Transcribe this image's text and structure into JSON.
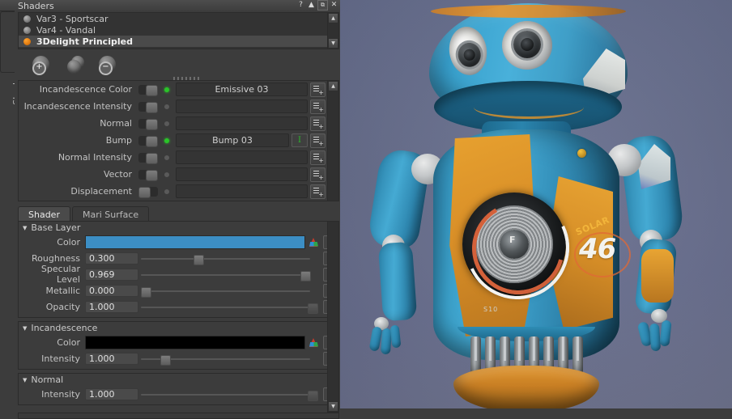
{
  "window": {
    "title": "Shaders",
    "side_tab": "Shaders",
    "buttons": [
      {
        "name": "help-button",
        "glyph": "?"
      },
      {
        "name": "float-button",
        "glyph": "▲"
      },
      {
        "name": "restore-button",
        "glyph": "⧉"
      },
      {
        "name": "close-button",
        "glyph": "✕"
      }
    ]
  },
  "shader_list": {
    "items": [
      {
        "label": "Var3 - Sportscar",
        "active": false
      },
      {
        "label": "Var4 - Vandal",
        "active": false
      },
      {
        "label": "3Delight Principled",
        "active": true
      }
    ],
    "scroll_up": "▲",
    "scroll_down": "▼"
  },
  "shader_toolbar": [
    {
      "name": "add-shader-button",
      "glyph": "+"
    },
    {
      "name": "duplicate-shader-button",
      "glyph": ""
    },
    {
      "name": "remove-shader-button",
      "glyph": "−"
    }
  ],
  "inputs": {
    "rows": [
      {
        "label": "Incandescence Color",
        "enabled": true,
        "connected": true,
        "value": "Emissive 03",
        "has_edit_button": false,
        "edit_glyph": ""
      },
      {
        "label": "Incandescence Intensity",
        "enabled": true,
        "connected": false,
        "value": "",
        "has_edit_button": false,
        "edit_glyph": ""
      },
      {
        "label": "Normal",
        "enabled": true,
        "connected": false,
        "value": "",
        "has_edit_button": false,
        "edit_glyph": ""
      },
      {
        "label": "Bump",
        "enabled": true,
        "connected": true,
        "value": "Bump 03",
        "has_edit_button": true,
        "edit_glyph": "I"
      },
      {
        "label": "Normal Intensity",
        "enabled": true,
        "connected": false,
        "value": "",
        "has_edit_button": false,
        "edit_glyph": ""
      },
      {
        "label": "Vector",
        "enabled": true,
        "connected": false,
        "value": "",
        "has_edit_button": false,
        "edit_glyph": ""
      },
      {
        "label": "Displacement",
        "enabled": false,
        "connected": false,
        "value": "",
        "has_edit_button": false,
        "edit_glyph": ""
      }
    ]
  },
  "tabs": [
    {
      "label": "Shader",
      "active": true
    },
    {
      "label": "Mari Surface",
      "active": false
    }
  ],
  "groups": [
    {
      "name": "Base Layer",
      "caret": "▼",
      "rows": [
        {
          "label": "Color",
          "kind": "color",
          "value": "",
          "color": "#3c8ec4",
          "reset": "R"
        },
        {
          "label": "Roughness",
          "kind": "slider",
          "value": "0.300",
          "fill": 0.3,
          "reset": "R"
        },
        {
          "label": "Specular Level",
          "kind": "slider",
          "value": "0.969",
          "fill": 0.969,
          "reset": "R"
        },
        {
          "label": "Metallic",
          "kind": "slider",
          "value": "0.000",
          "fill": 0.0,
          "reset": "R"
        },
        {
          "label": "Opacity",
          "kind": "slider",
          "value": "1.000",
          "fill": 1.0,
          "reset": "R"
        }
      ]
    },
    {
      "name": "Incandescence",
      "caret": "▼",
      "rows": [
        {
          "label": "Color",
          "kind": "color",
          "value": "",
          "color": "#000000",
          "reset": "R"
        },
        {
          "label": "Intensity",
          "kind": "slider",
          "value": "1.000",
          "fill": 0.12,
          "reset": "R"
        }
      ]
    },
    {
      "name": "Normal",
      "caret": "▼",
      "rows": [
        {
          "label": "Intensity",
          "kind": "slider",
          "value": "1.000",
          "fill": 1.0,
          "reset": "R"
        }
      ]
    }
  ],
  "viewport": {
    "model_decals": {
      "brand": "SOLAR",
      "number": "46",
      "panel_code": "S10",
      "chest_mark": "F"
    }
  },
  "colors": {
    "accent_orange": "#ff9c2a",
    "connected_green": "#29c428",
    "panel_bg": "#3c3c3c",
    "viewport_bg": "#6a7293",
    "base_color_swatch": "#3c8ec4"
  }
}
